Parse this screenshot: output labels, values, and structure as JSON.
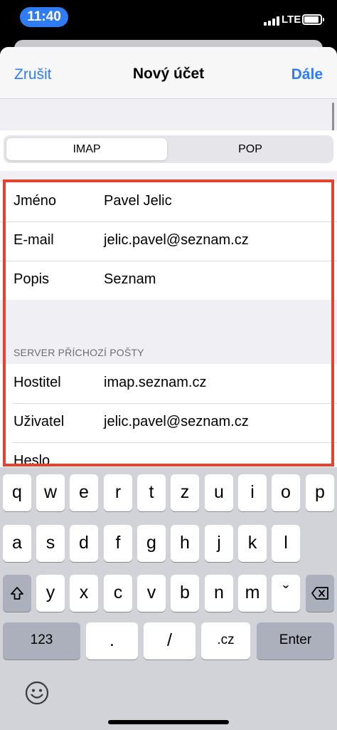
{
  "status_bar": {
    "time": "11:40",
    "network": "LTE"
  },
  "nav": {
    "cancel": "Zrušit",
    "title": "Nový účet",
    "next": "Dále"
  },
  "segments": {
    "imap": "IMAP",
    "pop": "POP",
    "selected": "IMAP"
  },
  "account": {
    "rows": [
      {
        "label": "Jméno",
        "value": "Pavel Jelic"
      },
      {
        "label": "E-mail",
        "value": "jelic.pavel@seznam.cz"
      },
      {
        "label": "Popis",
        "value": "Seznam"
      }
    ]
  },
  "incoming": {
    "header": "SERVER PŘÍCHOZÍ POŠTY",
    "rows": [
      {
        "label": "Hostitel",
        "value": "imap.seznam.cz"
      },
      {
        "label": "Uživatel",
        "value": "jelic.pavel@seznam.cz"
      },
      {
        "label": "Heslo",
        "value": ""
      }
    ]
  },
  "keyboard": {
    "row1": [
      "q",
      "w",
      "e",
      "r",
      "t",
      "z",
      "u",
      "i",
      "o",
      "p"
    ],
    "row2": [
      "a",
      "s",
      "d",
      "f",
      "g",
      "h",
      "j",
      "k",
      "l"
    ],
    "row3": [
      "y",
      "x",
      "c",
      "v",
      "b",
      "n",
      "m",
      "ˇ"
    ],
    "numbers_key": "123",
    "period_key": ".",
    "slash_key": "/",
    "domain_key": ".cz",
    "enter_key": "Enter"
  },
  "colors": {
    "accent": "#2f7cf6",
    "highlight": "#e4442f"
  },
  "icons": [
    "shift-icon",
    "backspace-icon",
    "emoji-icon"
  ]
}
